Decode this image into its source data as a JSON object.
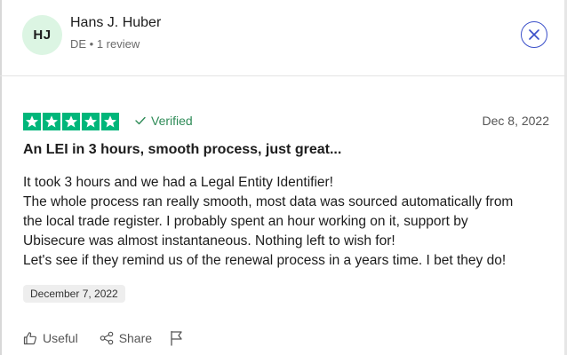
{
  "reviewer": {
    "initials": "HJ",
    "name": "Hans J. Huber",
    "meta": "DE • 1 review"
  },
  "colors": {
    "star_green": "#00b67a",
    "verified_green": "#2e8b57",
    "close_blue": "#3a4fc9",
    "avatar_bg": "#dcf5e3"
  },
  "review": {
    "rating": 5,
    "verified_label": "Verified",
    "date": "Dec 8, 2022",
    "title": "An LEI in 3 hours, smooth process, just great...",
    "body_lines": [
      "It took 3 hours and we had a Legal Entity Identifier!",
      "The whole process ran really smooth, most data was sourced automatically from",
      "the local trade register. I probably spent an hour working on it, support by",
      "Ubisecure was almost instantaneous. Nothing left to wish for!",
      "Let's see if they remind us of the renewal process in a years time. I bet they do!"
    ],
    "experience_date": "December 7, 2022"
  },
  "actions": {
    "useful_label": "Useful",
    "share_label": "Share"
  },
  "icons": [
    "close-icon",
    "star-icon",
    "check-icon",
    "thumbs-up-icon",
    "share-icon",
    "flag-icon"
  ]
}
